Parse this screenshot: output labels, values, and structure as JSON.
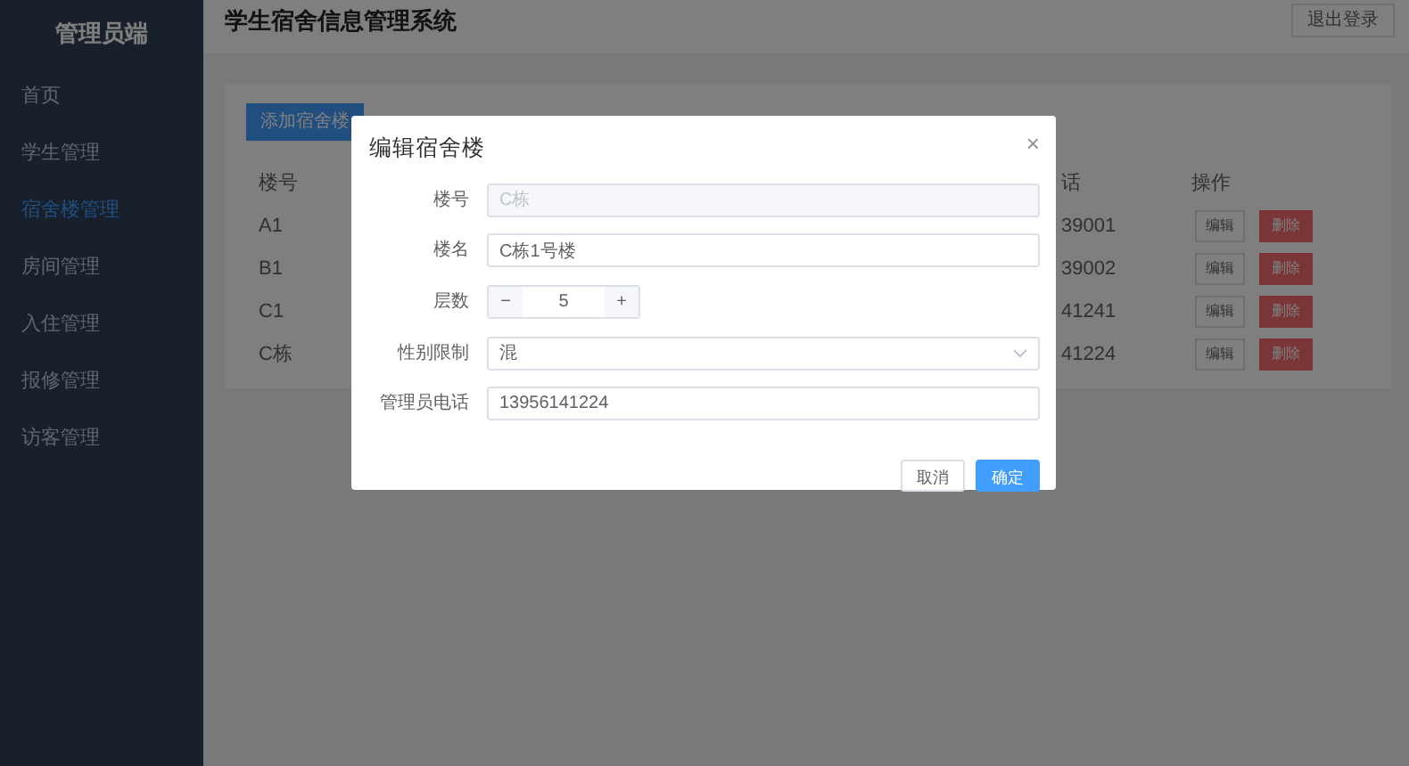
{
  "sidebar": {
    "title": "管理员端",
    "items": [
      {
        "label": "首页",
        "selected": false
      },
      {
        "label": "学生管理",
        "selected": false
      },
      {
        "label": "宿舍楼管理",
        "selected": true
      },
      {
        "label": "房间管理",
        "selected": false
      },
      {
        "label": "入住管理",
        "selected": false
      },
      {
        "label": "报修管理",
        "selected": false
      },
      {
        "label": "访客管理",
        "selected": false
      }
    ]
  },
  "header": {
    "title": "学生宿舍信息管理系统",
    "logout": "退出登录"
  },
  "add_button": "添加宿舍楼",
  "table": {
    "columns": [
      "楼号",
      "话",
      "操作"
    ],
    "rows": [
      {
        "cells": [
          "A1",
          "39001"
        ],
        "actions": [
          "编辑",
          "删除"
        ]
      },
      {
        "cells": [
          "B1",
          "39002"
        ],
        "actions": [
          "编辑",
          "删除"
        ]
      },
      {
        "cells": [
          "C1",
          "41241"
        ],
        "actions": [
          "编辑",
          "删除"
        ]
      },
      {
        "cells": [
          "C栋",
          "41224"
        ],
        "actions": [
          "编辑",
          "删除"
        ]
      }
    ]
  },
  "dialog": {
    "title": "编辑宿舍楼",
    "close": "×",
    "fields": [
      {
        "label": "楼号",
        "kind": "text",
        "value": "C栋",
        "disabled": true
      },
      {
        "label": "楼名",
        "kind": "text",
        "value": "C栋1号楼",
        "disabled": false
      },
      {
        "label": "层数",
        "kind": "number",
        "value": "5",
        "minus": "−",
        "plus": "+"
      },
      {
        "label": "性别限制",
        "kind": "select",
        "value": "混"
      },
      {
        "label": "管理员电话",
        "kind": "text",
        "value": "13956141224",
        "disabled": false
      }
    ],
    "buttons": [
      {
        "label": "取消",
        "primary": false
      },
      {
        "label": "确定",
        "primary": true
      }
    ]
  }
}
